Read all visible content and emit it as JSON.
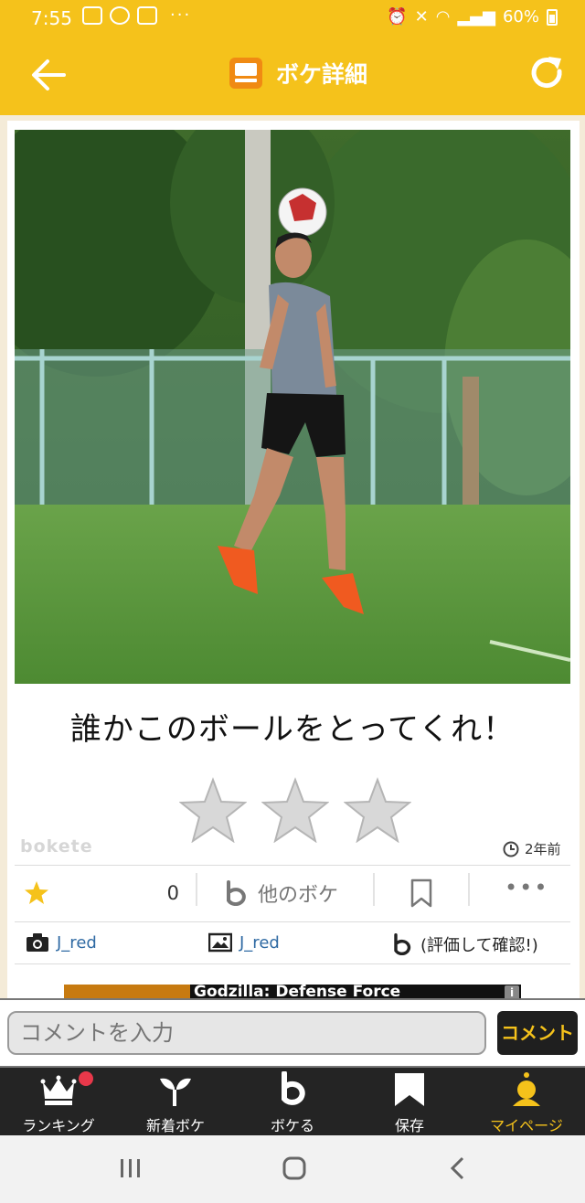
{
  "status_bar": {
    "time": "7:55",
    "more": "···",
    "battery": "60%"
  },
  "header": {
    "title": "ボケ詳細",
    "back_icon": "arrow-left-icon",
    "refresh_icon": "refresh-icon"
  },
  "post": {
    "boke_text": "誰かこのボールをとってくれ！",
    "rating_stars": 3,
    "watermark": "bokete",
    "time_ago": "2年前",
    "star_count": "0",
    "other_boke_label": "他のボケ",
    "more_label": "•••",
    "photo_credit": "J_red",
    "boke_credit": "J_red",
    "rating_credit": "(評価して確認!)"
  },
  "ad": {
    "title": "Godzilla: Defense Force",
    "info": "i"
  },
  "comment": {
    "placeholder": "コメントを入力",
    "button": "コメント"
  },
  "tabs": [
    {
      "label": "ランキング",
      "icon": "crown-icon",
      "badge": true
    },
    {
      "label": "新着ボケ",
      "icon": "sprout-icon"
    },
    {
      "label": "ボケる",
      "icon": "bokete-b-icon"
    },
    {
      "label": "保存",
      "icon": "bookmark-icon"
    },
    {
      "label": "マイページ",
      "icon": "mypage-icon",
      "active": true
    }
  ],
  "colors": {
    "accent": "#f5c21b",
    "tabbar": "#242424",
    "link": "#2f6aa3"
  }
}
